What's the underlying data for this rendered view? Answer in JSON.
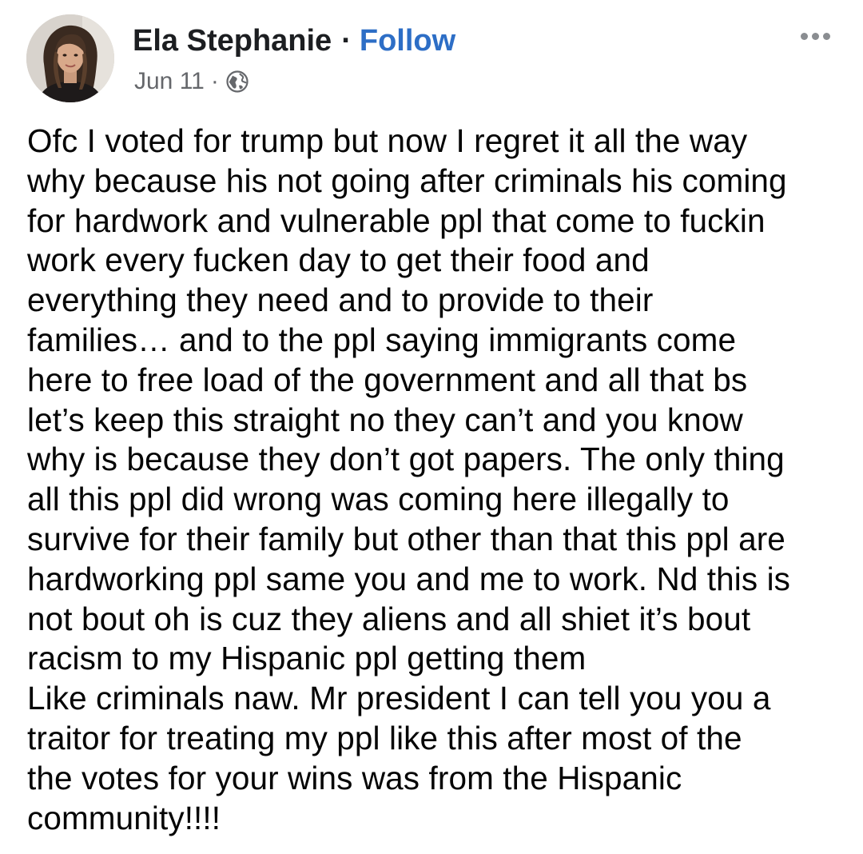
{
  "author": {
    "name": "Ela Stephanie",
    "separator": "·",
    "follow_label": "Follow"
  },
  "meta": {
    "date": "Jun 11",
    "separator": "·",
    "audience_icon": "globe-icon"
  },
  "more_icon": "more-options-icon",
  "post": {
    "lines": [
      "Ofc I voted for trump but now I regret it all the way",
      "why because his not going after criminals his coming",
      "for hardwork and vulnerable  ppl that come to fuckin",
      "work every fucken day to get their food and",
      "everything they need and to provide to their",
      "families… and to the ppl saying immigrants come",
      "here to free load of the government and all that bs",
      "let’s keep this straight no they can’t and you know",
      "why is because they don’t got papers. The only thing",
      "all this ppl did wrong was coming here illegally to",
      "survive for their family but other than that this ppl are",
      "hardworking ppl same you and me to work. Nd this is",
      "not bout oh is cuz they aliens and all shiet it’s bout",
      "racism to my Hispanic ppl getting them",
      "Like criminals naw. Mr president I can tell you you a",
      "traitor for treating my ppl like this after most of the",
      "the votes for your wins was from the Hispanic",
      "community!!!!"
    ]
  },
  "colors": {
    "follow": "#2d6ec6",
    "text": "#050505",
    "meta": "#65676b"
  }
}
